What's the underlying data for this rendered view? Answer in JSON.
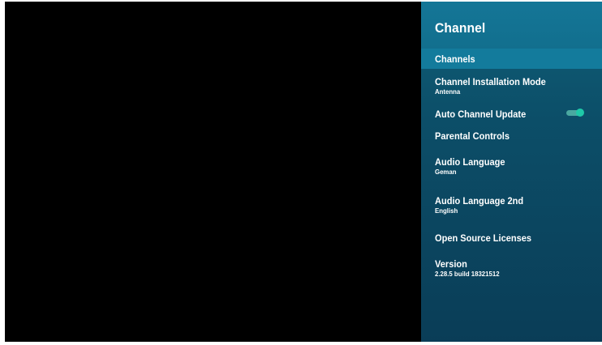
{
  "panel": {
    "title": "Channel",
    "items": [
      {
        "label": "Channels",
        "selected": true
      },
      {
        "label": "Channel Installation Mode",
        "value": "Antenna"
      },
      {
        "label": "Auto Channel Update",
        "toggle": true
      },
      {
        "label": "Parental Controls"
      },
      {
        "label": "Audio Language",
        "value": "Geman"
      },
      {
        "label": "Audio Language 2nd",
        "value": "English"
      },
      {
        "label": "Open Source Licenses"
      },
      {
        "label": "Version",
        "value": "2.28.5 build 18321512"
      }
    ]
  },
  "colors": {
    "panel_bg": "#0c4e68",
    "header_bg": "#147697",
    "selected_bg": "#137b9c",
    "toggle_on": "#1fc9a8"
  }
}
